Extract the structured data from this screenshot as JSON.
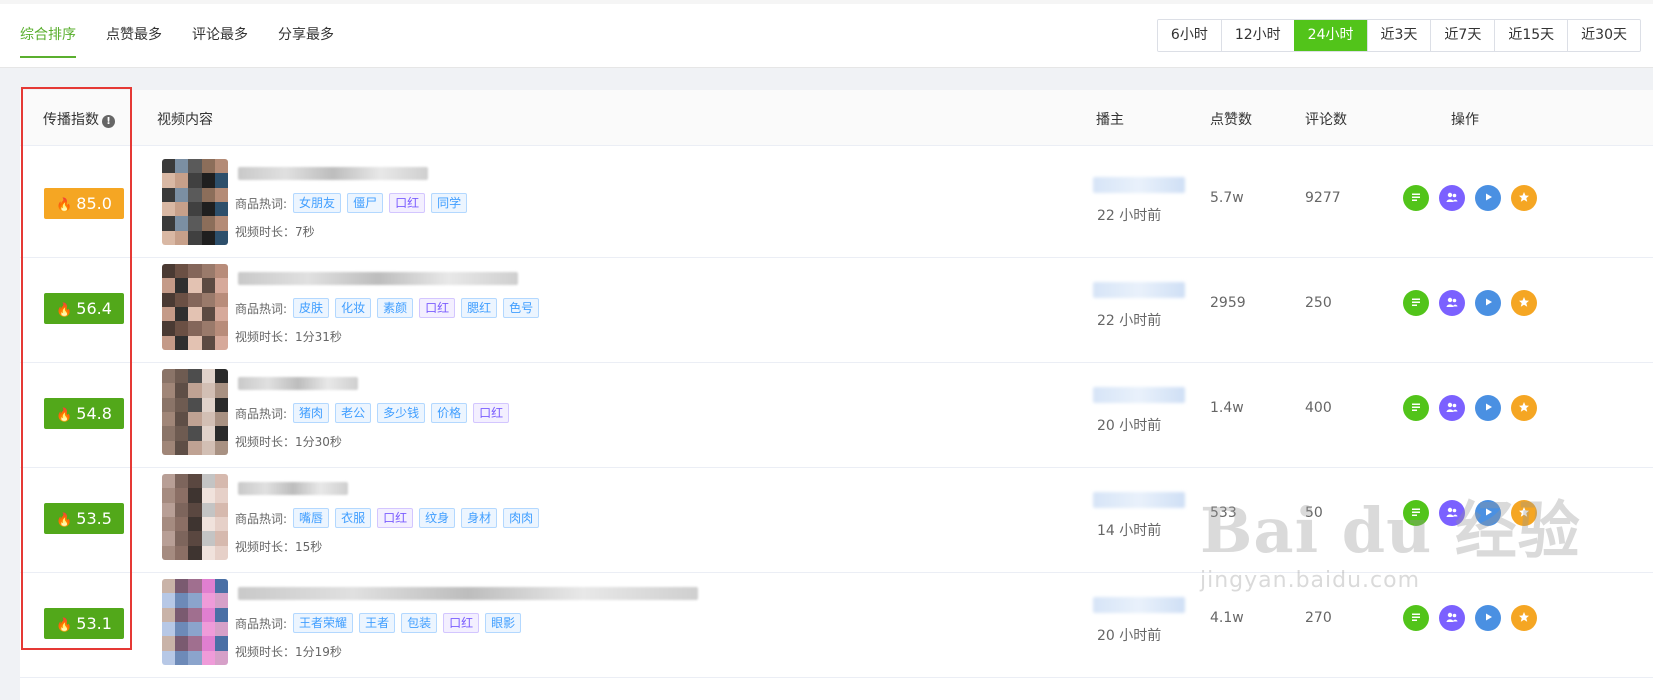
{
  "sort_tabs": [
    "综合排序",
    "点赞最多",
    "评论最多",
    "分享最多"
  ],
  "time_range": [
    "6小时",
    "12小时",
    "24小时",
    "近3天",
    "近7天",
    "近15天",
    "近30天"
  ],
  "table": {
    "headers": {
      "index": "传播指数",
      "video": "视频内容",
      "anchor": "播主",
      "likes": "点赞数",
      "comments": "评论数",
      "actions": "操作"
    },
    "hot_label": "商品热词:",
    "rows": [
      {
        "score": "85.0",
        "score_color": "#f5a623",
        "tags": [
          "女朋友",
          "僵尸",
          "口红",
          "同学"
        ],
        "duration": "视频时长：7秒",
        "time": "22 小时前",
        "likes": "5.7w",
        "comments": "9277"
      },
      {
        "score": "56.4",
        "score_color": "#52a81a",
        "tags": [
          "皮肤",
          "化妆",
          "素颜",
          "口红",
          "腮红",
          "色号"
        ],
        "duration": "视频时长：1分31秒",
        "time": "22 小时前",
        "likes": "2959",
        "comments": "250"
      },
      {
        "score": "54.8",
        "score_color": "#52a81a",
        "tags": [
          "猪肉",
          "老公",
          "多少钱",
          "价格",
          "口红"
        ],
        "duration": "视频时长：1分30秒",
        "time": "20 小时前",
        "likes": "1.4w",
        "comments": "400"
      },
      {
        "score": "53.5",
        "score_color": "#52a81a",
        "tags": [
          "嘴唇",
          "衣服",
          "口红",
          "纹身",
          "身材",
          "肉肉"
        ],
        "duration": "视频时长：15秒",
        "time": "14 小时前",
        "likes": "533",
        "comments": "50"
      },
      {
        "score": "53.1",
        "score_color": "#52a81a",
        "tags": [
          "王者荣耀",
          "王者",
          "包装",
          "口红",
          "眼影"
        ],
        "duration": "视频时长：1分19秒",
        "time": "20 小时前",
        "likes": "4.1w",
        "comments": "270"
      }
    ]
  },
  "watermark": {
    "big": "Bai du 经验",
    "small": "jingyan.baidu.com"
  },
  "colors": {
    "accent": "#52c41a",
    "highlight_border": "#e53935"
  },
  "icons": [
    "detail-icon",
    "fans-icon",
    "play-icon",
    "star-icon"
  ]
}
